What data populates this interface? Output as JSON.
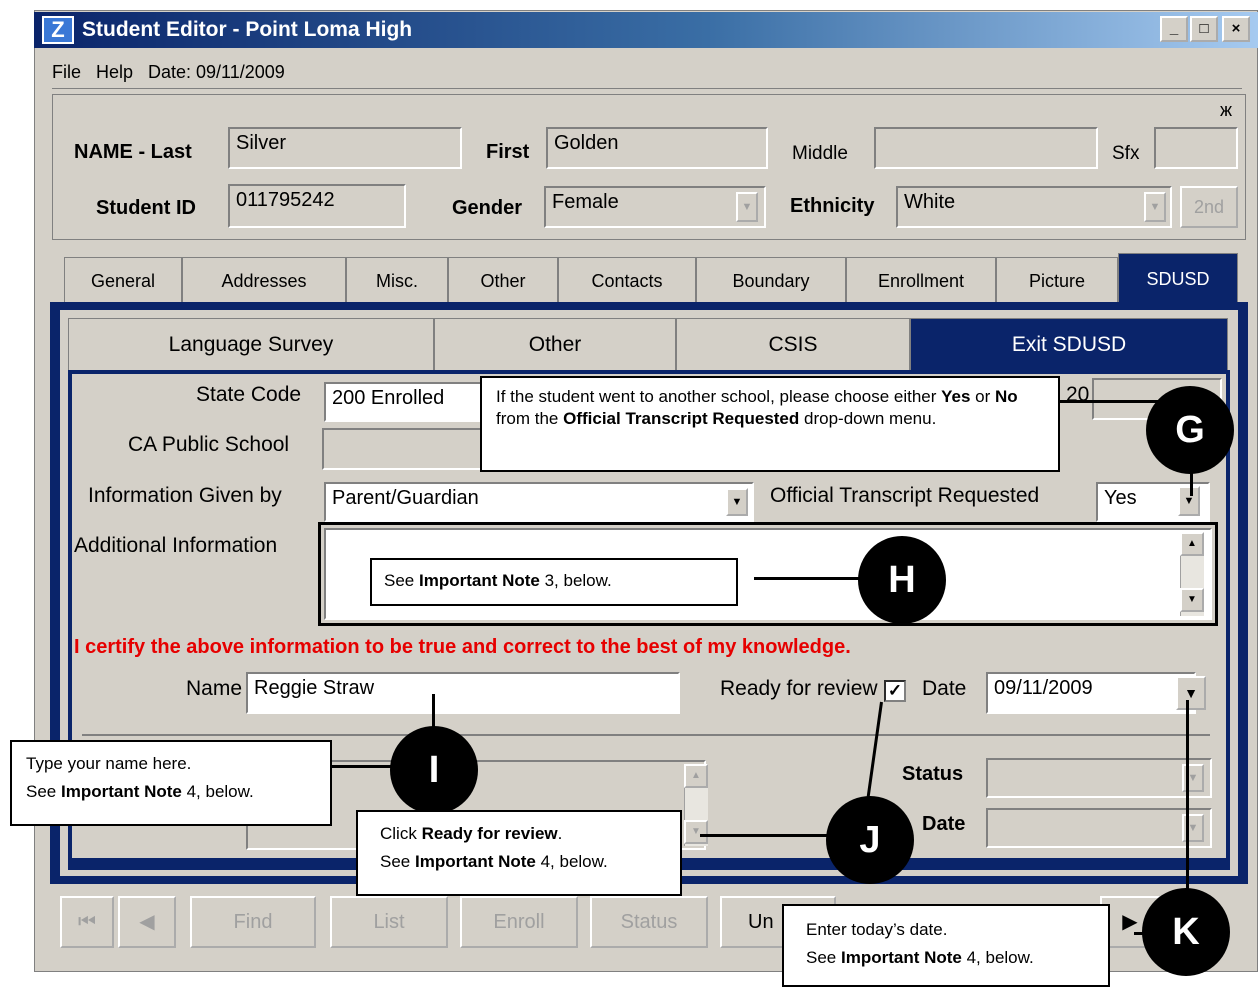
{
  "window": {
    "title": "Student Editor - Point Loma High",
    "min_glyph": "_",
    "max_glyph": "□",
    "close_glyph": "×"
  },
  "menu": {
    "file": "File",
    "help": "Help",
    "date": "Date: 09/11/2009"
  },
  "pin_glyph": "ж",
  "student": {
    "last_label": "NAME - Last",
    "last_value": "Silver",
    "first_label": "First",
    "first_value": "Golden",
    "middle_label": "Middle",
    "middle_value": "",
    "sfx_label": "Sfx",
    "sfx_value": "",
    "id_label": "Student ID",
    "id_value": "011795242",
    "gender_label": "Gender",
    "gender_value": "Female",
    "ethnicity_label": "Ethnicity",
    "ethnicity_value": "White",
    "second_button": "2nd"
  },
  "tabs": [
    "General",
    "Addresses",
    "Misc.",
    "Other",
    "Contacts",
    "Boundary",
    "Enrollment",
    "Picture",
    "SDUSD"
  ],
  "subtabs": [
    "Language Survey",
    "Other",
    "CSIS",
    "Exit SDUSD"
  ],
  "form": {
    "state_code_label": "State Code",
    "state_code_value": "200   Enrolled",
    "ca_public_label": "CA Public School",
    "info_given_label": "Information Given by",
    "info_given_value": "Parent/Guardian",
    "transcript_label": "Official Transcript Requested",
    "transcript_value": "Yes",
    "additional_label": "Additional Information",
    "certify": "I certify the above information to be true and correct to the best of my knowledge.",
    "name_label": "Name",
    "name_value": "Reggie Straw",
    "ready_label": "Ready for review",
    "ready_checked": true,
    "date_label": "Date",
    "date_value": "09/11/2009",
    "status_label": "Status",
    "status_date_label": "Date",
    "partial_year": "20"
  },
  "nav": {
    "find": "Find",
    "list": "List",
    "enroll": "Enroll",
    "status": "Status",
    "un": "Un"
  },
  "callouts": {
    "g_pre": "If the student went to another school, please choose either ",
    "g_yes": "Yes",
    "g_or": " or ",
    "g_no": "No",
    "g_mid": " from the ",
    "g_menu": "Official Transcript Requested",
    "g_post": " drop-down menu.",
    "h_pre": "See ",
    "h_bold": "Important Note",
    "h_post": " 3, below.",
    "i_line1": "Type your name here.",
    "i_pre": "See ",
    "i_bold": "Important Note",
    "i_post": " 4, below.",
    "j_pre": "Click ",
    "j_bold": "Ready for review",
    "j_dot": ".",
    "j_pre2": "See ",
    "j_bold2": "Important Note",
    "j_post": " 4, below.",
    "k_line1": "Enter today’s date.",
    "k_pre": "See ",
    "k_bold": "Important Note",
    "k_post": " 4, below."
  },
  "markers": {
    "g": "G",
    "h": "H",
    "i": "I",
    "j": "J",
    "k": "K"
  }
}
